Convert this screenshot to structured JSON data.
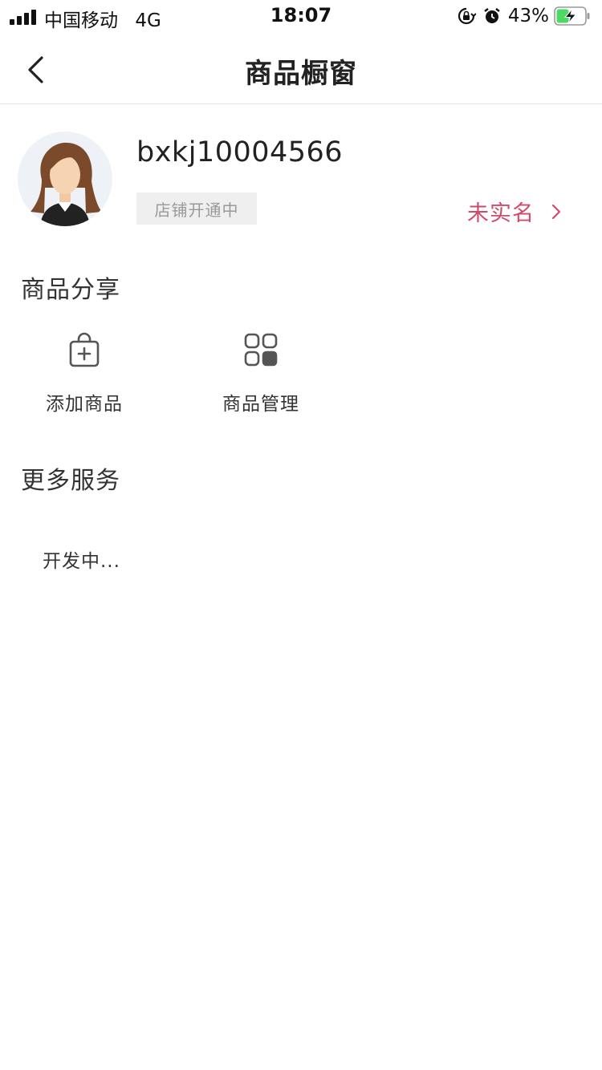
{
  "status_bar": {
    "carrier": "中国移动",
    "network": "4G",
    "time": "18:07",
    "battery_percent": "43%"
  },
  "nav": {
    "title": "商品橱窗"
  },
  "profile": {
    "username": "bxkj10004566",
    "shop_status": "店铺开通中",
    "verify_label": "未实名"
  },
  "sections": {
    "share": {
      "title": "商品分享",
      "items": [
        {
          "label": "添加商品",
          "icon": "shopping-bag-plus-icon"
        },
        {
          "label": "商品管理",
          "icon": "grid-apps-icon"
        }
      ]
    },
    "more": {
      "title": "更多服务",
      "placeholder": "开发中..."
    }
  },
  "colors": {
    "accent": "#d24a6b",
    "badge_bg": "#efefef",
    "badge_text": "#999999",
    "divider": "#e2e2e2"
  }
}
